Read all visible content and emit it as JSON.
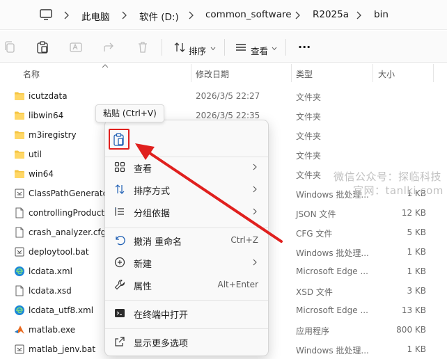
{
  "address": {
    "items": [
      "此电脑",
      "软件 (D:)",
      "common_software",
      "R2025a",
      "bin"
    ]
  },
  "toolbar": {
    "sort_label": "排序",
    "view_label": "查看",
    "more_label": "···"
  },
  "columns": {
    "name": "名称",
    "date": "修改日期",
    "type": "类型",
    "size": "大小"
  },
  "files": [
    {
      "name": "icutzdata",
      "date": "2026/3/5 22:27",
      "type": "文件夹",
      "size": "",
      "icon": "folder-icon"
    },
    {
      "name": "libwin64",
      "date": "2026/3/5 22:35",
      "type": "文件夹",
      "size": "",
      "icon": "folder-icon"
    },
    {
      "name": "m3iregistry",
      "date": "",
      "type": "文件夹",
      "size": "",
      "icon": "folder-icon"
    },
    {
      "name": "util",
      "date": "",
      "type": "文件夹",
      "size": "",
      "icon": "folder-icon"
    },
    {
      "name": "win64",
      "date": "",
      "type": "文件夹",
      "size": "",
      "icon": "folder-icon"
    },
    {
      "name": "ClassPathGenerator",
      "date": "",
      "type": "Windows 批处理...",
      "size": "1 KB",
      "icon": "batch-file-icon"
    },
    {
      "name": "controllingProduct",
      "date": "",
      "type": "JSON 文件",
      "size": "12 KB",
      "icon": "file-icon"
    },
    {
      "name": "crash_analyzer.cfg",
      "date": "",
      "type": "CFG 文件",
      "size": "5 KB",
      "icon": "file-icon"
    },
    {
      "name": "deploytool.bat",
      "date": "",
      "type": "Windows 批处理...",
      "size": "1 KB",
      "icon": "batch-file-icon"
    },
    {
      "name": "lcdata.xml",
      "date": "",
      "type": "Microsoft Edge ...",
      "size": "1 KB",
      "icon": "edge-icon"
    },
    {
      "name": "lcdata.xsd",
      "date": "",
      "type": "XSD 文件",
      "size": "3 KB",
      "icon": "file-icon"
    },
    {
      "name": "lcdata_utf8.xml",
      "date": "",
      "type": "Microsoft Edge ...",
      "size": "13 KB",
      "icon": "edge-icon"
    },
    {
      "name": "matlab.exe",
      "date": "",
      "type": "应用程序",
      "size": "800 KB",
      "icon": "matlab-icon"
    },
    {
      "name": "matlab_jenv.bat",
      "date": "",
      "type": "Windows 批处理...",
      "size": "1 KB",
      "icon": "batch-file-icon"
    }
  ],
  "tooltip": {
    "text": "粘贴 (Ctrl+V)"
  },
  "context_menu": {
    "items": [
      {
        "label": "查看",
        "shortcut": "",
        "submenu": true,
        "icon": "grid-icon"
      },
      {
        "label": "排序方式",
        "shortcut": "",
        "submenu": true,
        "icon": "sort-icon"
      },
      {
        "label": "分组依据",
        "shortcut": "",
        "submenu": true,
        "icon": "group-icon"
      },
      {
        "label": "撤消 重命名",
        "shortcut": "Ctrl+Z",
        "submenu": false,
        "icon": "undo-icon"
      },
      {
        "label": "新建",
        "shortcut": "",
        "submenu": true,
        "icon": "new-icon"
      },
      {
        "label": "属性",
        "shortcut": "Alt+Enter",
        "submenu": false,
        "icon": "wrench-icon"
      },
      {
        "label": "在终端中打开",
        "shortcut": "",
        "submenu": false,
        "icon": "terminal-icon"
      },
      {
        "label": "显示更多选项",
        "shortcut": "",
        "submenu": false,
        "icon": "share-icon"
      }
    ]
  },
  "watermark": {
    "line1": "微信公众号：探临科技",
    "line2": "官网：tanlki.com"
  },
  "colors": {
    "highlight": "#e0201e",
    "folder": "#f5c542",
    "accent": "#0067c0"
  }
}
